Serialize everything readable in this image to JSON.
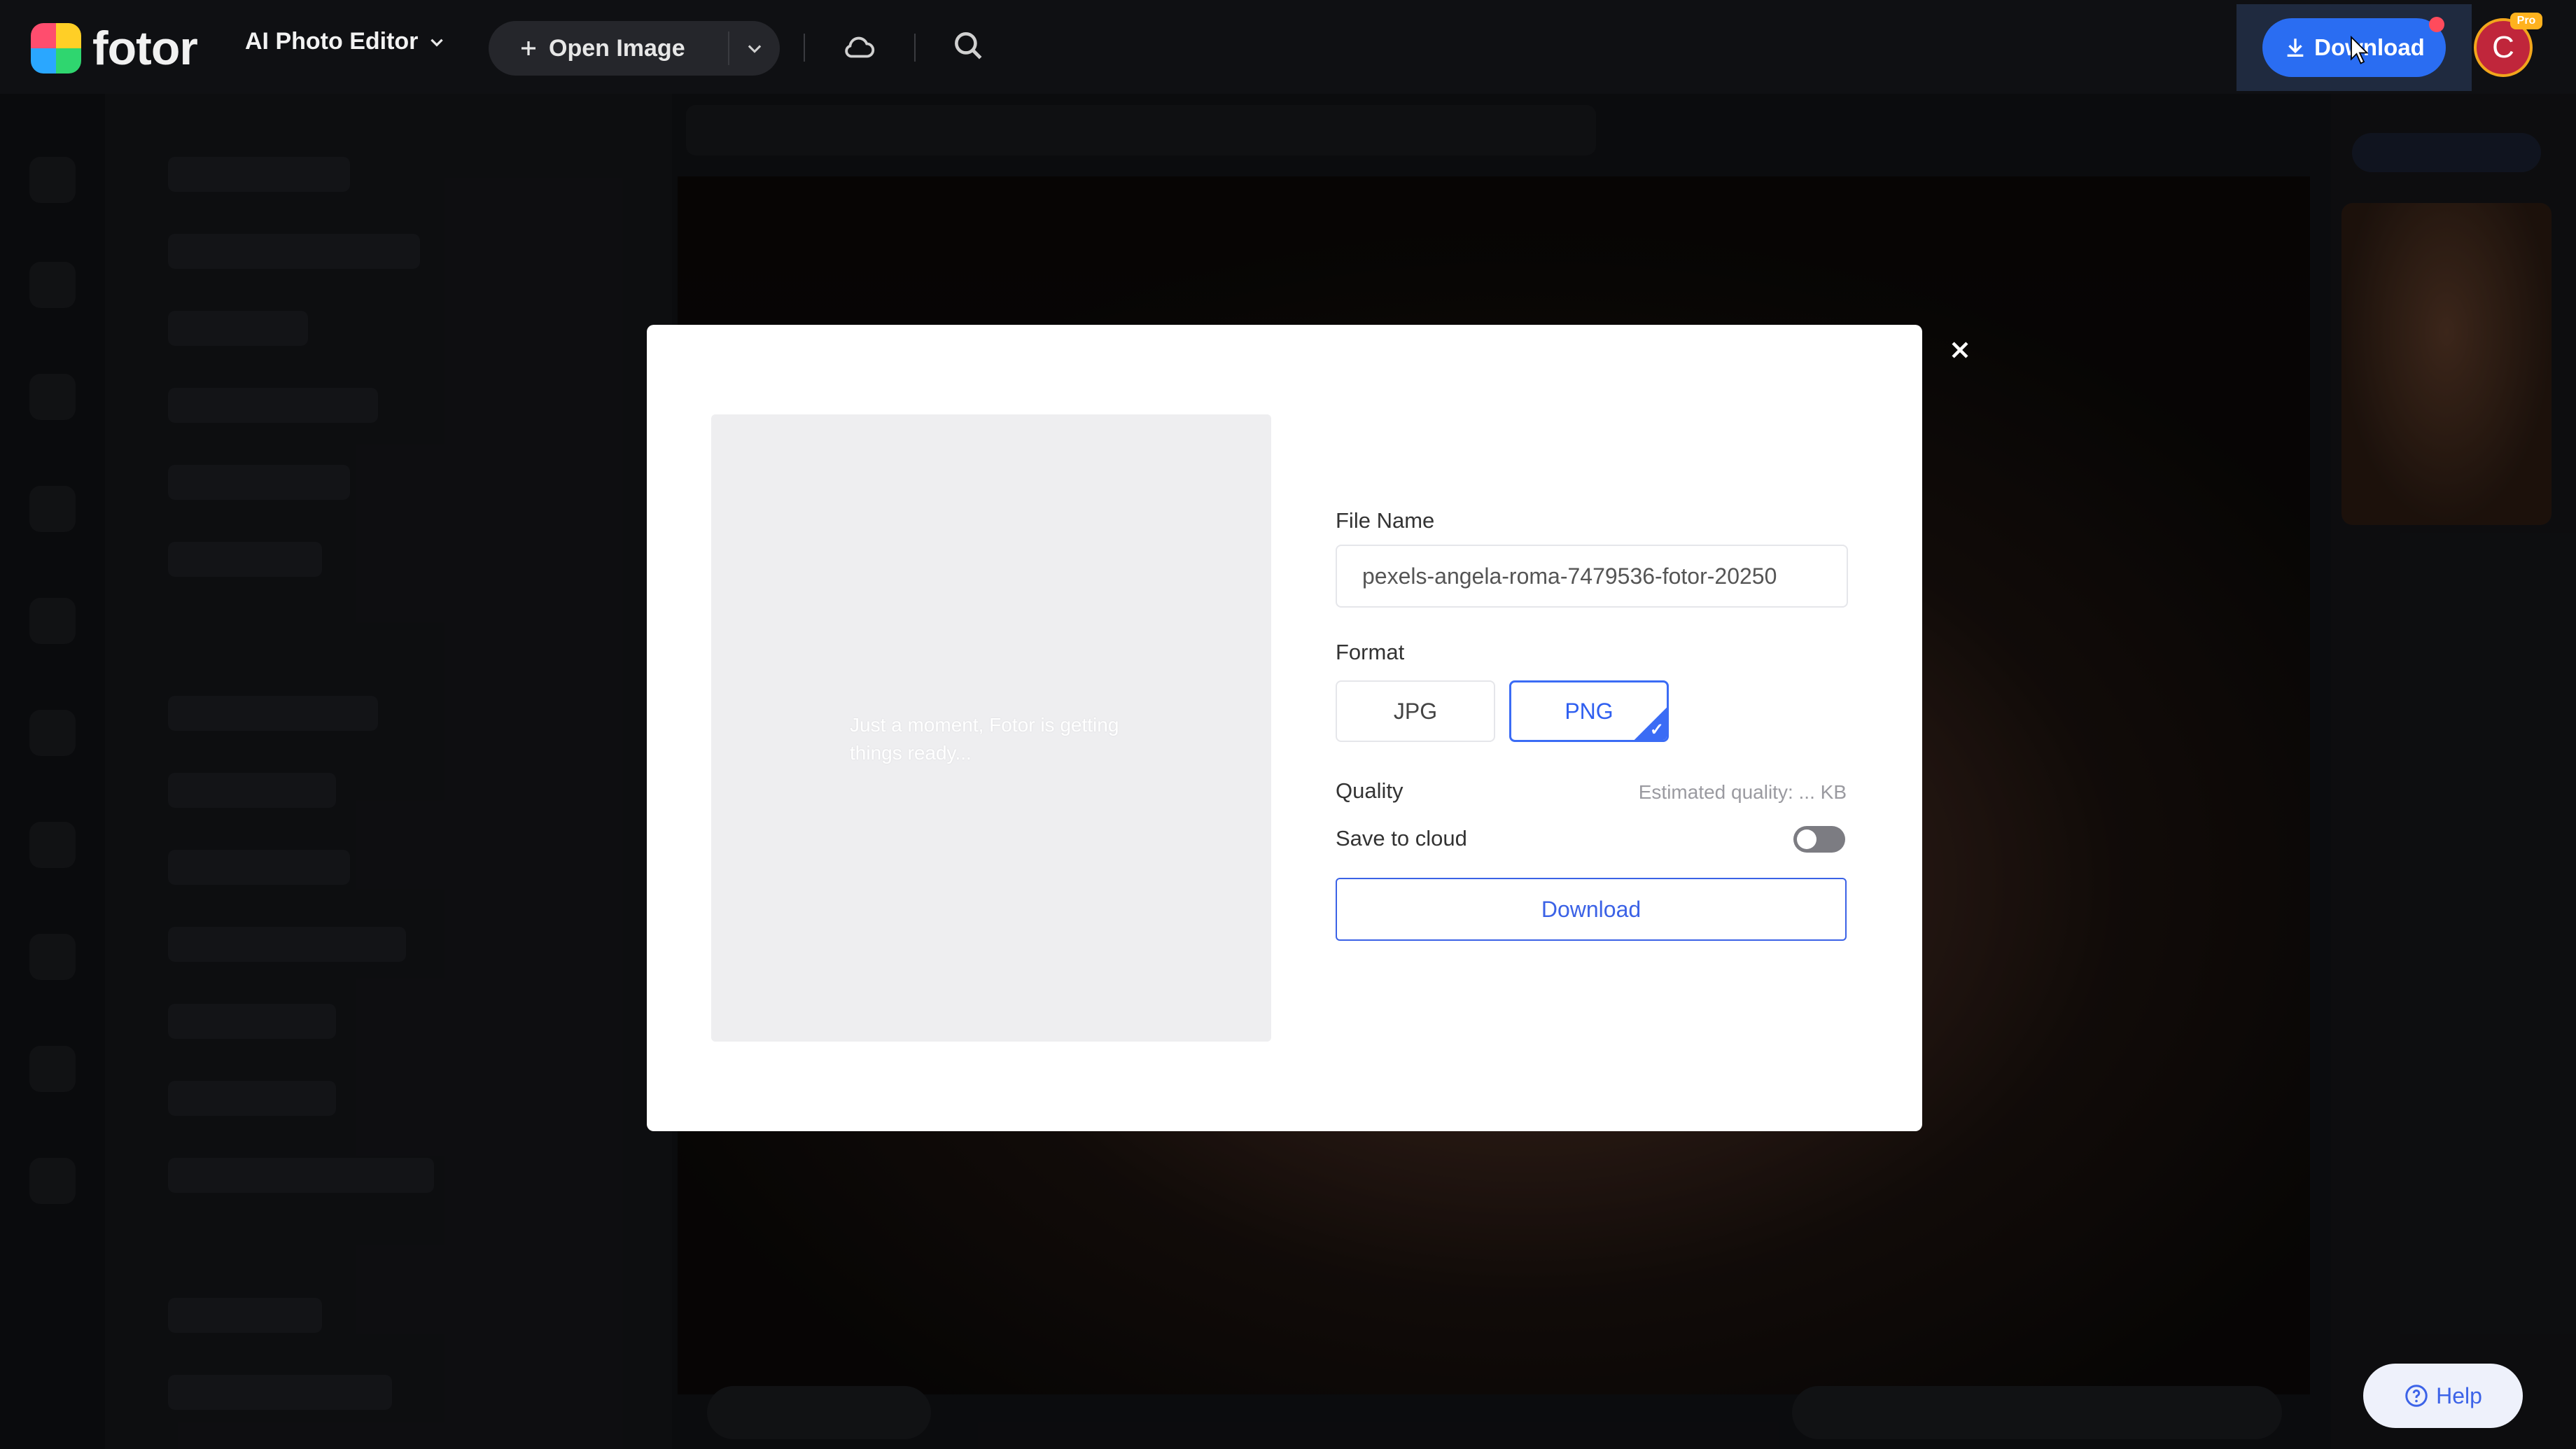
{
  "app": {
    "logo_text": "fotor",
    "editor_menu": "AI Photo Editor",
    "open_image_label": "Open Image",
    "download_label": "Download",
    "avatar_initial": "C",
    "pro_badge": "Pro",
    "help_label": "Help"
  },
  "icons": {
    "chevron": "chevron-down-icon",
    "plus": "plus-icon",
    "cloud": "cloud-icon",
    "search": "search-icon",
    "download": "download-icon",
    "close": "close-icon",
    "help": "help-icon",
    "check": "check-icon"
  },
  "modal": {
    "preview_message": "Just a moment, Fotor is getting things ready...",
    "file_name_label": "File Name",
    "file_name_value": "pexels-angela-roma-7479536-fotor-20250",
    "format_label": "Format",
    "formats": [
      "JPG",
      "PNG"
    ],
    "selected_format": "PNG",
    "quality_label": "Quality",
    "estimated_quality": "Estimated quality: ... KB",
    "save_to_cloud_label": "Save to cloud",
    "save_to_cloud_on": false,
    "download_button": "Download"
  },
  "colors": {
    "accent": "#3b6cf5",
    "top_download": "#2a6df2",
    "avatar": "#c0263b",
    "pro_badge": "#ffb21e"
  }
}
